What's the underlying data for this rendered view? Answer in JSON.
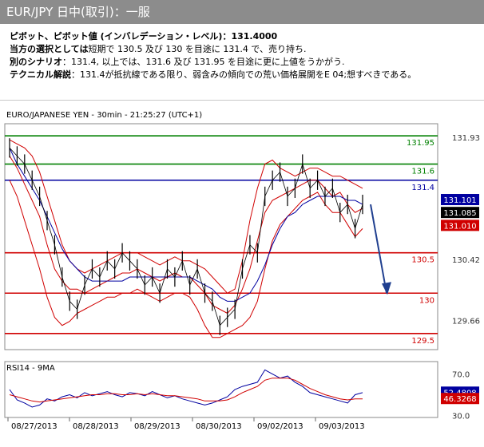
{
  "header": {
    "title": "EUR/JPY 日中(取引)：一服"
  },
  "info": {
    "pivot_label": "ピボット、ピボット値 (インバレデーション・レベル)：",
    "pivot_value": "131.4000",
    "pref_label": "当方の選択としては",
    "pref_text": "短期で 130.5 及び 130 を目途に 131.4 で、売り持ち.",
    "alt_label": "別のシナリオ",
    "alt_text": "：131.4, 以上では、131.6 及び 131.95 を目途に更に上値をうかがう.",
    "tech_label": "テクニカル解説",
    "tech_text": "：131.4が抵抗線である限り、弱含みの傾向での荒い価格展開をE 04;想すべきである。"
  },
  "chart_data": [
    {
      "type": "line",
      "title": "EURO/JAPANESE YEN - 30min - 21:25:27 (UTC+1)",
      "ylim": [
        129.3,
        132.1
      ],
      "y_ticks": [
        "131.93",
        "130.42",
        "129.66"
      ],
      "x_labels": [
        "08/27/2013",
        "08/28/2013",
        "08/29/2013",
        "08/30/2013",
        "09/02/2013",
        "09/03/2013"
      ],
      "levels": [
        {
          "label": "131.95",
          "value": 131.95,
          "color": "#008000"
        },
        {
          "label": "131.6",
          "value": 131.6,
          "color": "#008000"
        },
        {
          "label": "131.4",
          "value": 131.4,
          "color": "#0000a0"
        },
        {
          "label": "130.5",
          "value": 130.5,
          "color": "#d00000"
        },
        {
          "label": "130",
          "value": 130.0,
          "color": "#d00000"
        },
        {
          "label": "129.5",
          "value": 129.5,
          "color": "#d00000"
        }
      ],
      "price_tags": [
        {
          "label": "131.101",
          "value": 131.16,
          "bg": "#0000a0"
        },
        {
          "label": "131.085",
          "value": 131.0,
          "bg": "#000000"
        },
        {
          "label": "131.010",
          "value": 130.84,
          "bg": "#d00000"
        }
      ],
      "series": [
        {
          "values": [
            131.7,
            131.55,
            131.35,
            131.15,
            130.95,
            130.6,
            130.3,
            130.15,
            130.05,
            130.05,
            130.0,
            130.05,
            130.1,
            130.15,
            130.2,
            130.25,
            130.25,
            130.3,
            130.25,
            130.2,
            130.15,
            130.2,
            130.25,
            130.2,
            130.2,
            130.1,
            130.0,
            129.85,
            129.8,
            129.75,
            129.85,
            130.05,
            130.3,
            130.65,
            131.0,
            131.15,
            131.2,
            131.25,
            131.3,
            131.35,
            131.4,
            131.4,
            131.3,
            131.2,
            131.25,
            131.1,
            131.0,
            131.05
          ]
        },
        {
          "values": [
            131.9,
            131.85,
            131.8,
            131.7,
            131.5,
            131.2,
            130.9,
            130.6,
            130.4,
            130.3,
            130.25,
            130.3,
            130.35,
            130.4,
            130.45,
            130.5,
            130.5,
            130.5,
            130.45,
            130.4,
            130.35,
            130.4,
            130.45,
            130.4,
            130.4,
            130.35,
            130.3,
            130.2,
            130.1,
            130.0,
            130.05,
            130.4,
            130.9,
            131.3,
            131.6,
            131.65,
            131.55,
            131.5,
            131.45,
            131.5,
            131.55,
            131.55,
            131.5,
            131.45,
            131.45,
            131.4,
            131.35,
            131.3
          ]
        },
        {
          "values": [
            131.4,
            131.2,
            130.9,
            130.6,
            130.3,
            129.95,
            129.7,
            129.6,
            129.65,
            129.75,
            129.8,
            129.85,
            129.9,
            129.95,
            129.95,
            130.0,
            130.0,
            130.05,
            130.0,
            129.95,
            129.9,
            129.95,
            130.0,
            130.0,
            129.95,
            129.8,
            129.6,
            129.45,
            129.45,
            129.5,
            129.55,
            129.6,
            129.7,
            129.9,
            130.3,
            130.65,
            130.85,
            130.95,
            131.05,
            131.15,
            131.2,
            131.25,
            131.1,
            131.0,
            131.0,
            130.85,
            130.7,
            130.8
          ]
        },
        {
          "values": [
            131.8,
            131.6,
            131.45,
            131.3,
            131.15,
            130.95,
            130.75,
            130.55,
            130.4,
            130.3,
            130.2,
            130.15,
            130.15,
            130.15,
            130.15,
            130.15,
            130.2,
            130.2,
            130.2,
            130.2,
            130.2,
            130.2,
            130.2,
            130.2,
            130.2,
            130.15,
            130.1,
            130.05,
            129.95,
            129.9,
            129.9,
            129.95,
            130.0,
            130.15,
            130.35,
            130.6,
            130.8,
            130.95,
            131.0,
            131.1,
            131.15,
            131.2,
            131.2,
            131.2,
            131.2,
            131.15,
            131.15,
            131.1
          ]
        }
      ],
      "price": [
        131.8,
        131.7,
        131.6,
        131.4,
        131.2,
        130.9,
        130.6,
        130.2,
        129.9,
        129.8,
        130.1,
        130.3,
        130.2,
        130.4,
        130.3,
        130.5,
        130.4,
        130.3,
        130.1,
        130.2,
        130.0,
        130.3,
        130.2,
        130.4,
        130.1,
        130.3,
        130.0,
        129.9,
        129.6,
        129.7,
        129.8,
        130.3,
        130.6,
        130.5,
        131.2,
        131.4,
        131.5,
        131.2,
        131.3,
        131.6,
        131.3,
        131.4,
        131.2,
        131.3,
        131.0,
        131.1,
        130.8,
        131.1
      ]
    },
    {
      "type": "line",
      "title": "RSI14 - 9MA",
      "ylim": [
        28,
        82
      ],
      "y_ticks": [
        "70.0",
        "30.0"
      ],
      "tags": [
        {
          "label": "52.4808",
          "value": 52.4808,
          "bg": "#0000a0"
        },
        {
          "label": "46.3268",
          "value": 46.3268,
          "bg": "#d00000"
        }
      ],
      "series": [
        {
          "values": [
            55,
            45,
            42,
            38,
            40,
            46,
            44,
            48,
            50,
            47,
            52,
            49,
            51,
            53,
            50,
            48,
            52,
            51,
            49,
            53,
            50,
            47,
            49,
            46,
            44,
            42,
            40,
            42,
            45,
            48,
            55,
            58,
            60,
            62,
            74,
            70,
            66,
            68,
            62,
            58,
            52,
            50,
            48,
            46,
            44,
            42,
            50,
            52
          ]
        },
        {
          "values": [
            50,
            48,
            46,
            44,
            43,
            44,
            45,
            46,
            47,
            48,
            49,
            50,
            50,
            51,
            51,
            50,
            50,
            51,
            50,
            51,
            50,
            49,
            49,
            48,
            47,
            46,
            44,
            44,
            44,
            45,
            48,
            52,
            55,
            58,
            64,
            66,
            66,
            66,
            64,
            60,
            56,
            53,
            50,
            48,
            46,
            45,
            46,
            46
          ]
        }
      ]
    }
  ]
}
